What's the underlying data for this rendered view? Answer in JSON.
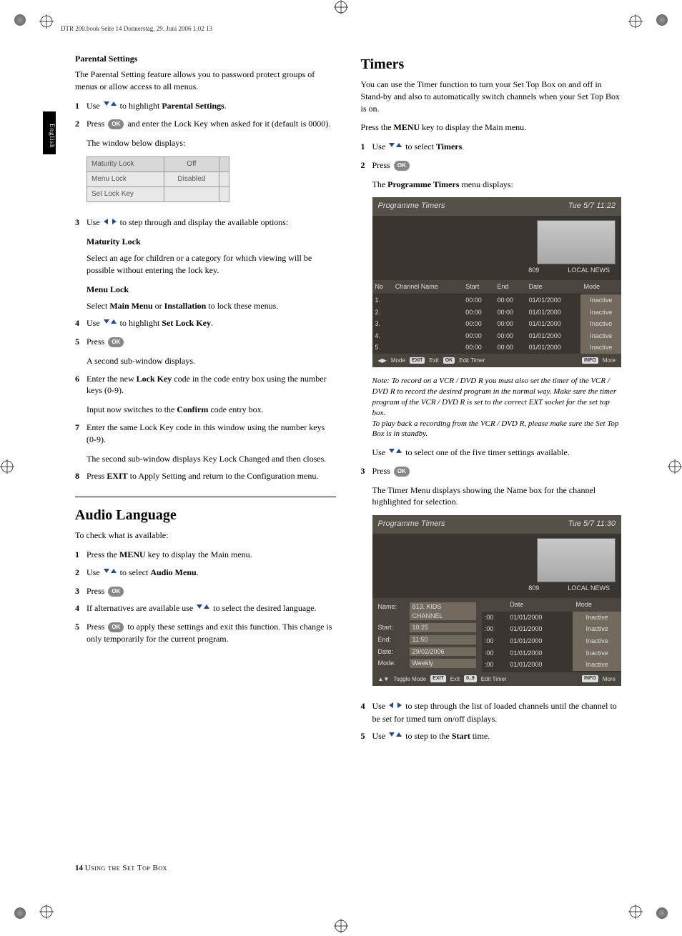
{
  "header": "DTR 200.book  Seite 14  Donnerstag, 29. Juni 2006  1:02 13",
  "langTab": "English",
  "left": {
    "parental": {
      "title": "Parental Settings",
      "intro": "The Parental Setting feature allows you to password protect groups of menus or allow access to all menus.",
      "s1a": "Use ",
      "s1b": " to highlight ",
      "s1c": "Parental Settings",
      "s1d": ".",
      "s2a": "Press ",
      "s2b": " and enter the Lock Key when asked for it (default is 0000).",
      "s2c": "The window below displays:",
      "table": {
        "r1a": "Maturity Lock",
        "r1b": "Off",
        "r2a": "Menu Lock",
        "r2b": "Disabled",
        "r3a": "Set Lock Key",
        "r3b": ""
      },
      "s3a": "Use ",
      "s3b": " to step through and display the available options:",
      "matTitle": "Maturity Lock",
      "matText": "Select an age for children or a category for which viewing will be possible without entering the lock key.",
      "menuTitle": "Menu Lock",
      "menuTextA": " Select ",
      "menuTextB": "Main Menu",
      "menuTextC": " or ",
      "menuTextD": "Installation",
      "menuTextE": " to lock these menus.",
      "s4a": "Use ",
      "s4b": " to highlight ",
      "s4c": "Set Lock Key",
      "s4d": ".",
      "s5a": "Press ",
      "s5b": "A second sub-window displays.",
      "s6a": "Enter the new ",
      "s6b": "Lock Key",
      "s6c": " code in the code entry box using the number keys (0-9).",
      "s6d": "Input now switches to the ",
      "s6e": "Confirm",
      "s6f": " code entry box.",
      "s7": "Enter the same Lock Key code in this window using the number keys (0-9).",
      "s7b": "The second sub-window displays Key Lock Changed and then closes.",
      "s8a": "Press ",
      "s8b": "EXIT",
      "s8c": " to Apply Setting and return to the Configuration menu."
    },
    "audio": {
      "title": "Audio Language",
      "intro": "To check what is available:",
      "s1a": "Press the ",
      "s1b": "MENU",
      "s1c": " key to display the Main menu.",
      "s2a": "Use ",
      "s2b": " to select ",
      "s2c": "Audio Menu",
      "s2d": ".",
      "s3": "Press ",
      "s4a": "If alternatives are available use ",
      "s4b": " to select the desired language.",
      "s5a": "Press ",
      "s5b": " to apply these settings and exit this function. This change is only temporarily for the current program."
    }
  },
  "right": {
    "timers": {
      "title": "Timers",
      "intro": "You can use the Timer function to turn your Set Top Box on and off in Stand-by and also to automatically switch channels when your Set Top Box is on.",
      "pressMenuA": "Press the ",
      "pressMenuB": "MENU",
      "pressMenuC": " key to display the Main menu.",
      "s1a": "Use ",
      "s1b": " to select ",
      "s1c": "Timers",
      "s1d": ".",
      "s2": "Press ",
      "s2b": "The ",
      "s2c": "Programme Timers",
      "s2d": " menu displays:",
      "noteA": "Note:  To record on a VCR / DVD R you must also set the timer of the VCR / DVD R to record the desired program in the normal way. Make sure the timer program of the VCR / DVD R is set to the correct EXT socket for the set top box.",
      "noteB": "To play back a recording from the VCR / DVD R, please make sure the Set Top Box is in standby.",
      "useSelectA": "Use ",
      "useSelectB": " to select one of the five timer settings available.",
      "s3a": "Press ",
      "s3b": "The Timer Menu displays showing the Name box for the channel highlighted for selection.",
      "s4a": "Use ",
      "s4b": " to step through the list of loaded channels until the channel to be set for timed turn on/off displays.",
      "s5a": "Use ",
      "s5b": " to step to the ",
      "s5c": "Start",
      "s5d": " time."
    },
    "ss1": {
      "title": "Programme Timers",
      "time": "Tue 5/7 11:22",
      "chNum": "809",
      "chName": "LOCAL NEWS",
      "headers": {
        "no": "No",
        "ch": "Channel Name",
        "start": "Start",
        "end": "End",
        "date": "Date",
        "mode": "Mode"
      },
      "rows": [
        {
          "no": "1.",
          "start": "00:00",
          "end": "00:00",
          "date": "01/01/2000",
          "mode": "Inactive"
        },
        {
          "no": "2.",
          "start": "00:00",
          "end": "00:00",
          "date": "01/01/2000",
          "mode": "Inactive"
        },
        {
          "no": "3.",
          "start": "00:00",
          "end": "00:00",
          "date": "01/01/2000",
          "mode": "Inactive"
        },
        {
          "no": "4.",
          "start": "00:00",
          "end": "00:00",
          "date": "01/01/2000",
          "mode": "Inactive"
        },
        {
          "no": "5.",
          "start": "00:00",
          "end": "00:00",
          "date": "01/01/2000",
          "mode": "Inactive"
        }
      ],
      "footer": {
        "mode": "Mode",
        "exit": "Exit",
        "edit": "Edit Timer",
        "more": "More",
        "btnExit": "EXIT",
        "btnOk": "OK",
        "btnInfo": "INFO"
      }
    },
    "ss2": {
      "title": "Programme Timers",
      "time": "Tue 5/7 11:30",
      "chNum": "809",
      "chName": "LOCAL NEWS",
      "detail": {
        "nameLbl": "Name:",
        "name": "813. KIDS CHANNEL",
        "startLbl": "Start:",
        "start": "10:25",
        "endLbl": "End:",
        "end": "11:50",
        "dateLbl": "Date:",
        "date": "29/02/2006",
        "modeLbl": "Mode:",
        "mode": "Weekly"
      },
      "headers": {
        "date": "Date",
        "mode": "Mode"
      },
      "rows": [
        {
          "t": ":00",
          "date": "01/01/2000",
          "mode": "Inactive"
        },
        {
          "t": ":00",
          "date": "01/01/2000",
          "mode": "Inactive"
        },
        {
          "t": ":00",
          "date": "01/01/2000",
          "mode": "Inactive"
        },
        {
          "t": ":00",
          "date": "01/01/2000",
          "mode": "Inactive"
        },
        {
          "t": ":00",
          "date": "01/01/2000",
          "mode": "Inactive"
        }
      ],
      "footer": {
        "toggle": "Toggle Mode",
        "exit": "Exit",
        "edit": "Edit Timer",
        "more": "More",
        "btnExit": "EXIT",
        "btn09": "0..9",
        "btnInfo": "INFO"
      }
    }
  },
  "footer": {
    "num": "14",
    "text": "Using the Set Top Box"
  }
}
